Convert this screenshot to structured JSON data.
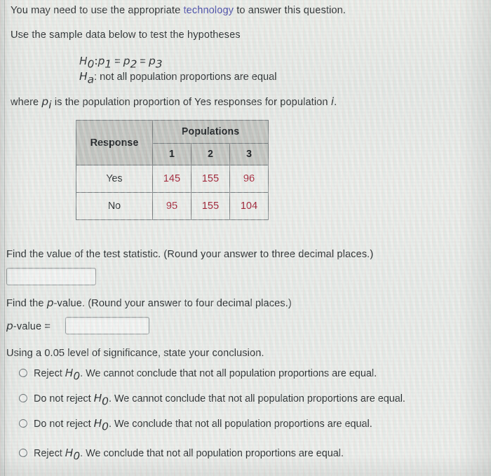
{
  "intro": {
    "prefix": "You may need to use the appropriate ",
    "link": "technology",
    "suffix": " to answer this question.",
    "instruction": "Use the sample data below to test the hypotheses"
  },
  "hypotheses": {
    "null_prefix": "H",
    "null_sub": "0",
    "null_colon": ":",
    "null_p1": "p",
    "null_p1_sub": "1",
    "eq1": " = ",
    "null_p2": "p",
    "null_p2_sub": "2",
    "eq2": " = ",
    "null_p3": "p",
    "null_p3_sub": "3",
    "alt_prefix": "H",
    "alt_sub": "a",
    "alt_text": ": not all population proportions are equal"
  },
  "where_note": {
    "before": "where ",
    "var": "p",
    "var_sub": "i",
    "after_a": " is the population proportion of Yes responses for population ",
    "italic_i": "i",
    "period": "."
  },
  "table": {
    "corner_header": "Response",
    "group_header": "Populations",
    "column_headers": [
      "1",
      "2",
      "3"
    ],
    "rows": [
      {
        "label": "Yes",
        "values": [
          "145",
          "155",
          "96"
        ]
      },
      {
        "label": "No",
        "values": [
          "95",
          "155",
          "104"
        ]
      }
    ],
    "header_bg": "#c5c7c2",
    "value_color": "#a6293c",
    "border_color": "#7b8183"
  },
  "test_statistic": {
    "prompt": "Find the value of the test statistic. (Round your answer to three decimal places.)",
    "value": "",
    "placeholder": ""
  },
  "p_value": {
    "prompt_before": "Find the ",
    "prompt_var": "p",
    "prompt_after": "-value. (Round your answer to four decimal places.)",
    "label_var": "p",
    "label_after": "-value =",
    "value": "",
    "placeholder": ""
  },
  "conclusion": {
    "prompt": "Using a 0.05 level of significance, state your conclusion.",
    "options": [
      {
        "lead": "Reject ",
        "h": "H",
        "h_sub": "0",
        "rest": ". We cannot conclude that not all population proportions are equal.",
        "selected": false
      },
      {
        "lead": "Do not reject ",
        "h": "H",
        "h_sub": "0",
        "rest": ". We cannot conclude that not all population proportions are equal.",
        "selected": false
      },
      {
        "lead": "Do not reject ",
        "h": "H",
        "h_sub": "0",
        "rest": ". We conclude that not all population proportions are equal.",
        "selected": false
      },
      {
        "lead": "Reject ",
        "h": "H",
        "h_sub": "0",
        "rest": ". We conclude that not all population proportions are equal.",
        "selected": false
      }
    ]
  },
  "colors": {
    "link": "#4a4ea8",
    "text": "#2d3133",
    "page_bg": "#e9ece8"
  }
}
